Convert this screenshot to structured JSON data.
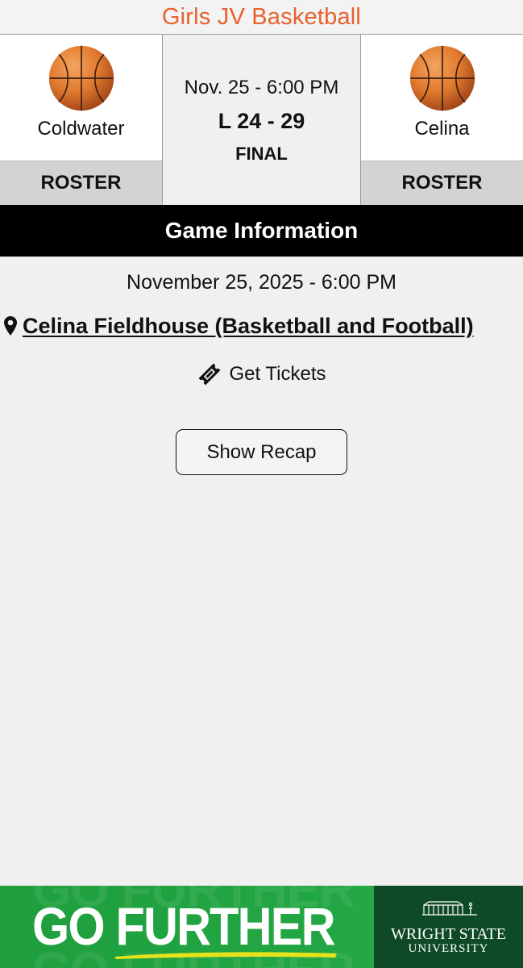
{
  "header": {
    "title": "Girls JV Basketball"
  },
  "home_team": {
    "name": "Coldwater",
    "roster_label": "ROSTER",
    "icon": "basketball-icon"
  },
  "away_team": {
    "name": "Celina",
    "roster_label": "ROSTER",
    "icon": "basketball-icon"
  },
  "game": {
    "when": "Nov. 25 - 6:00 PM",
    "score": "L 24 - 29",
    "status": "FINAL"
  },
  "info": {
    "title": "Game Information",
    "date": "November 25, 2025 - 6:00 PM",
    "venue": "Celina Fieldhouse (Basketball and Football)",
    "venue_icon": "map-pin-icon",
    "tickets_label": "Get Tickets",
    "tickets_icon": "ticket-icon",
    "recap_label": "Show Recap"
  },
  "ad": {
    "headline": "GO FURTHER",
    "sponsor_name": "WRIGHT STATE",
    "sponsor_sub": "UNIVERSITY"
  },
  "colors": {
    "header_text": "#e8612c",
    "ball": "#e07a2e",
    "info_bar": "#000000",
    "ad_green": "#1f9e3d",
    "ad_dark_green": "#0f4a26",
    "ad_yellow": "#e8e21a"
  }
}
